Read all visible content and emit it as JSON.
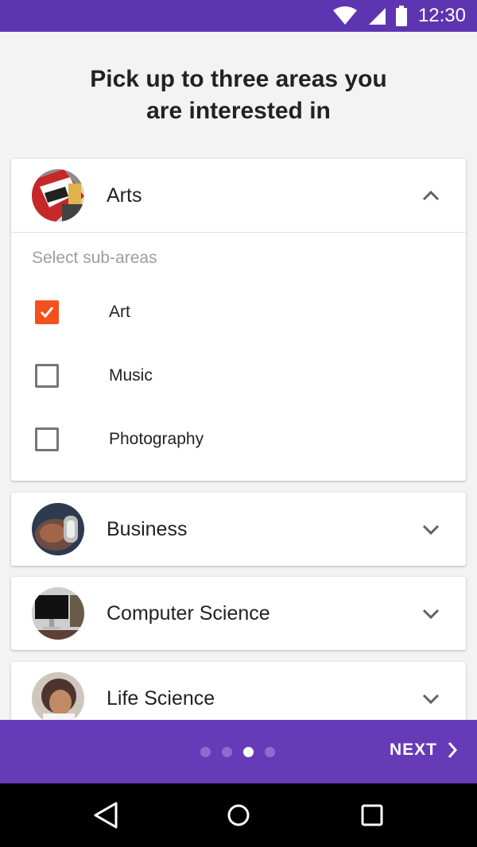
{
  "status_bar": {
    "time": "12:30",
    "icons": [
      "wifi-icon",
      "cell-signal-icon",
      "battery-icon"
    ],
    "color": "#5e35b1"
  },
  "heading": {
    "line1": "Pick up to three areas you",
    "line2": "are interested in"
  },
  "areas": [
    {
      "title": "Arts",
      "expanded": true,
      "sub_label": "Select sub-areas",
      "sub_areas": [
        {
          "label": "Art",
          "checked": true
        },
        {
          "label": "Music",
          "checked": false
        },
        {
          "label": "Photography",
          "checked": false
        }
      ]
    },
    {
      "title": "Business",
      "expanded": false
    },
    {
      "title": "Computer Science",
      "expanded": false
    },
    {
      "title": "Life Science",
      "expanded": false
    }
  ],
  "footer": {
    "next_label": "NEXT",
    "page_count": 4,
    "current_page": 3,
    "color": "#673ab7"
  },
  "nav_bar": {
    "icons": [
      "back-icon",
      "home-icon",
      "recents-icon"
    ]
  },
  "colors": {
    "accent": "#f4511e",
    "primary": "#673ab7",
    "primary_dark": "#5e35b1"
  }
}
